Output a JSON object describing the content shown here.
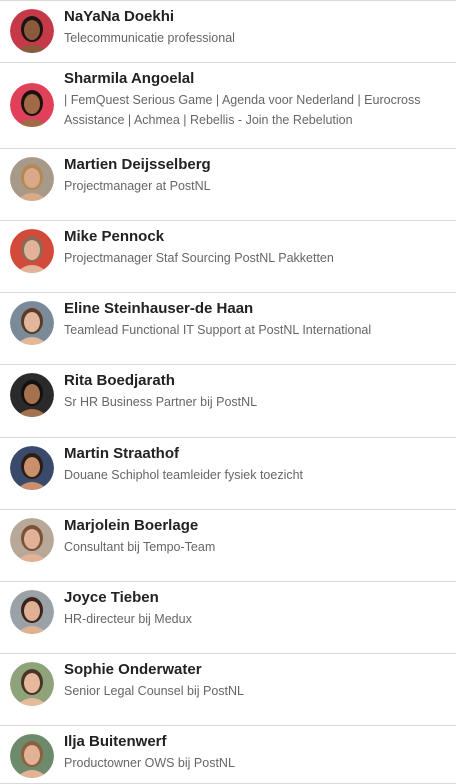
{
  "connections": [
    {
      "name": "NaYaNa Doekhi",
      "headline": "Telecommunicatie professional",
      "avatar_icon": "profile-photo-icon",
      "avatar_bg": "#c43a49",
      "skin": "#8a5a3c",
      "hair": "#1b1410"
    },
    {
      "name": "Sharmila Angoelal",
      "headline": "| FemQuest Serious Game | Agenda voor Nederland | Eurocross Assistance | Achmea | Rebellis - Join the Rebelution",
      "avatar_icon": "profile-photo-icon",
      "avatar_bg": "#e0405a",
      "skin": "#a06a45",
      "hair": "#1a120d"
    },
    {
      "name": "Martien Deijsselberg",
      "headline": "Projectmanager at PostNL",
      "avatar_icon": "profile-photo-icon",
      "avatar_bg": "#a89a88",
      "skin": "#d9a98a",
      "hair": "#b38a55"
    },
    {
      "name": "Mike Pennock",
      "headline": "Projectmanager Staf Sourcing PostNL Pakketten",
      "avatar_icon": "profile-photo-icon",
      "avatar_bg": "#d44a3a",
      "skin": "#e0b39a",
      "hair": "#8a6a55"
    },
    {
      "name": "Eline Steinhauser-de Haan",
      "headline": "Teamlead Functional IT Support at PostNL International",
      "avatar_icon": "profile-photo-icon",
      "avatar_bg": "#7a8a98",
      "skin": "#e3b79b",
      "hair": "#5a3a28"
    },
    {
      "name": "Rita Boedjarath",
      "headline": "Sr HR Business Partner bij PostNL",
      "avatar_icon": "profile-photo-icon",
      "avatar_bg": "#2a2a2a",
      "skin": "#a57250",
      "hair": "#141010"
    },
    {
      "name": "Martin Straathof",
      "headline": "Douane Schiphol teamleider fysiek toezicht",
      "avatar_icon": "profile-photo-icon",
      "avatar_bg": "#3a4a6a",
      "skin": "#c9906b",
      "hair": "#2a1d16"
    },
    {
      "name": "Marjolein Boerlage",
      "headline": "Consultant bij Tempo-Team",
      "avatar_icon": "profile-photo-icon",
      "avatar_bg": "#b8a898",
      "skin": "#e2b296",
      "hair": "#7a5235"
    },
    {
      "name": "Joyce Tieben",
      "headline": "HR-directeur bij Medux",
      "avatar_icon": "profile-photo-icon",
      "avatar_bg": "#9aa2a8",
      "skin": "#e0b094",
      "hair": "#3a2418"
    },
    {
      "name": "Sophie Onderwater",
      "headline": "Senior Legal Counsel bij PostNL",
      "avatar_icon": "profile-photo-icon",
      "avatar_bg": "#8fa37a",
      "skin": "#e4b99c",
      "hair": "#4a3428"
    },
    {
      "name": "Ilja Buitenwerf",
      "headline": "Productowner OWS bij PostNL",
      "avatar_icon": "profile-photo-icon",
      "avatar_bg": "#6d8a6a",
      "skin": "#e1b295",
      "hair": "#8a6040"
    }
  ]
}
